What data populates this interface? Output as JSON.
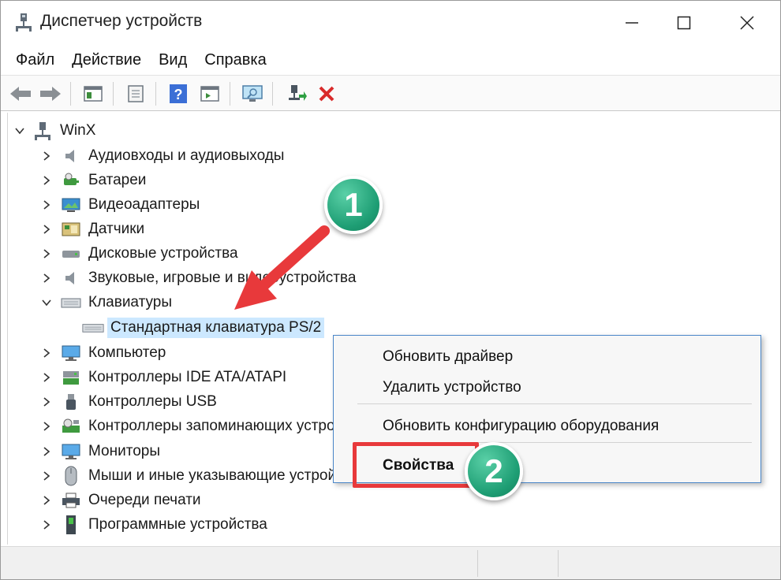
{
  "window": {
    "title": "Диспетчер устройств",
    "controls": {
      "minimize": "minimize",
      "maximize": "maximize",
      "close": "close"
    }
  },
  "menubar": {
    "items": [
      "Файл",
      "Действие",
      "Вид",
      "Справка"
    ]
  },
  "toolbar": {
    "buttons": [
      "back-arrow-icon",
      "forward-arrow-icon",
      "console-tree-icon",
      "properties-icon",
      "help-icon",
      "action-pane-icon",
      "scan-hardware-icon",
      "update-driver-icon",
      "uninstall-icon"
    ]
  },
  "tree": {
    "root": "WinX",
    "categories": [
      {
        "label": "Аудиовходы и аудиовыходы",
        "expanded": false
      },
      {
        "label": "Батареи",
        "expanded": false
      },
      {
        "label": "Видеоадаптеры",
        "expanded": false
      },
      {
        "label": "Датчики",
        "expanded": false
      },
      {
        "label": "Дисковые устройства",
        "expanded": false
      },
      {
        "label": "Звуковые, игровые и видеоустройства",
        "expanded": false
      },
      {
        "label": "Клавиатуры",
        "expanded": true
      },
      {
        "label": "Компьютер",
        "expanded": false
      },
      {
        "label": "Контроллеры IDE ATA/ATAPI",
        "expanded": false
      },
      {
        "label": "Контроллеры USB",
        "expanded": false
      },
      {
        "label": "Контроллеры запоминающих устройств",
        "expanded": false
      },
      {
        "label": "Мониторы",
        "expanded": false
      },
      {
        "label": "Мыши и иные указывающие устройства",
        "expanded": false
      },
      {
        "label": "Очереди печати",
        "expanded": false
      },
      {
        "label": "Программные устройства",
        "expanded": false
      }
    ],
    "selected_child": "Стандартная клавиатура PS/2"
  },
  "context_menu": {
    "items": [
      "Обновить драйвер",
      "Удалить устройство",
      "Обновить конфигурацию оборудования",
      "Свойства"
    ]
  },
  "annotations": {
    "badge1": "1",
    "badge2": "2",
    "badge_color": "#1e9e74",
    "arrow_color": "#e8393b",
    "highlight_color": "#e8393b"
  },
  "colors": {
    "selection": "#cce8ff",
    "menu_border": "#4a86c8"
  }
}
